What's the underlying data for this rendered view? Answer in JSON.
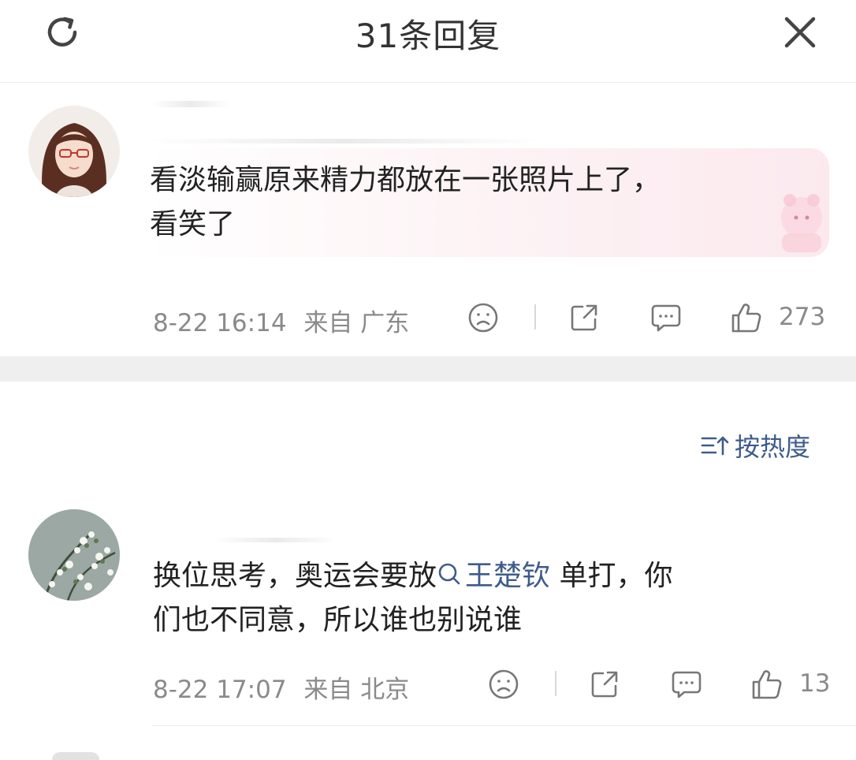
{
  "header": {
    "title": "31条回复",
    "refresh_icon": "refresh-icon",
    "close_icon": "close-icon"
  },
  "comments": [
    {
      "text_lines": [
        "看淡输赢原来精力都放在一张照片上了，",
        "看笑了"
      ],
      "date": "8-22 16:14",
      "location": "来自 广东",
      "likes": "273"
    },
    {
      "text_before": "换位思考，奥运会要放",
      "mention": "王楚钦",
      "text_after": " 单打，你",
      "text_line2": "们也不同意，所以谁也别说谁",
      "date": "8-22 17:07",
      "location": "来自 北京",
      "likes": "13"
    }
  ],
  "sort": {
    "label": "按热度",
    "icon": "sort-icon"
  },
  "colors": {
    "link": "#3d5c8c",
    "meta": "#8a8a8a",
    "text": "#222222",
    "section_gap": "#efefef",
    "bubble_pink": "#fbe9ee"
  }
}
